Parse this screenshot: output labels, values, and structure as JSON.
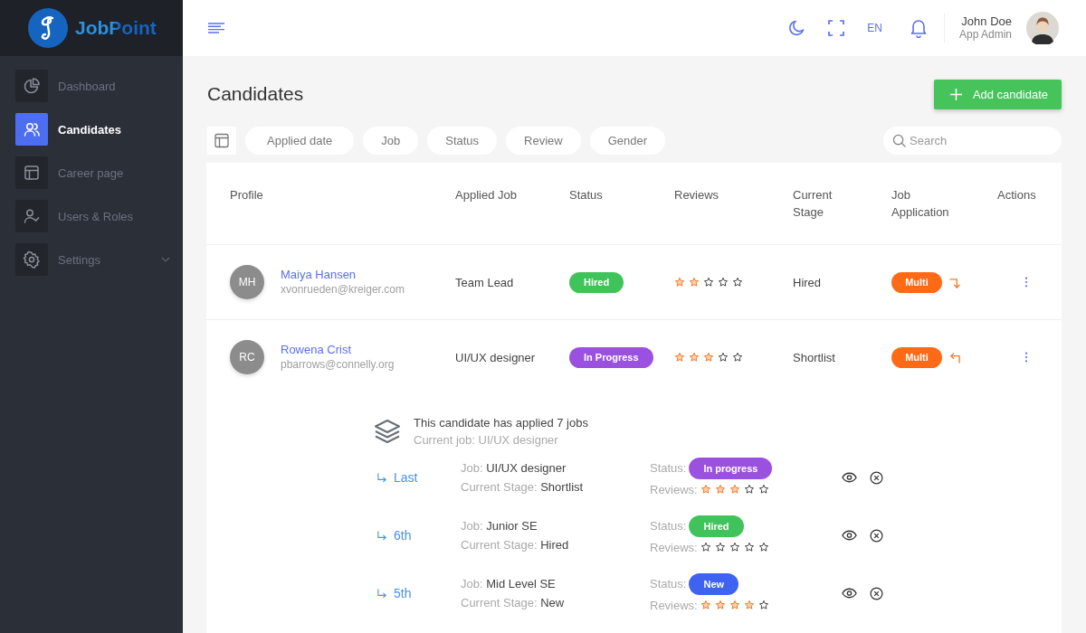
{
  "sidebar": {
    "brand": "JobPoint",
    "items": [
      {
        "label": "Dashboard",
        "selected": false,
        "submenu": false
      },
      {
        "label": "Candidates",
        "selected": true,
        "submenu": false
      },
      {
        "label": "Career page",
        "selected": false,
        "submenu": false
      },
      {
        "label": "Users & Roles",
        "selected": false,
        "submenu": false
      },
      {
        "label": "Settings",
        "selected": false,
        "submenu": true
      }
    ]
  },
  "topbar": {
    "language": "EN",
    "user": {
      "name": "John Doe",
      "role": "App Admin"
    }
  },
  "page": {
    "title": "Candidates",
    "add_button": "Add candidate"
  },
  "filters": {
    "chips": [
      "Applied date",
      "Job",
      "Status",
      "Review",
      "Gender"
    ],
    "search": {
      "placeholder": "Search"
    }
  },
  "table": {
    "columns": [
      "Profile",
      "Applied Job",
      "Status",
      "Reviews",
      "Current Stage",
      "Job Application",
      "Actions"
    ],
    "rows": [
      {
        "initials": "MH",
        "name": "Maiya Hansen",
        "email": "xvonrueden@kreiger.com",
        "job": "Team Lead",
        "status": {
          "label": "Hired",
          "color": "#41c35b"
        },
        "stars": 2,
        "stage": "Hired",
        "application": "Multi",
        "expanded": false
      },
      {
        "initials": "RC",
        "name": "Rowena Crist",
        "email": "pbarrows@connelly.org",
        "job": "UI/UX designer",
        "status": {
          "label": "In Progress",
          "color": "#9b51e0"
        },
        "stars": 3,
        "stage": "Shortlist",
        "application": "Multi",
        "expanded": true,
        "details": {
          "summary": "This candidate has applied 7 jobs",
          "current": "Current job: UI/UX designer",
          "applications": [
            {
              "order": "Last",
              "job_label": "Job:",
              "job": "UI/UX designer",
              "stage_label": "Current Stage:",
              "stage": "Shortlist",
              "status_label": "Status:",
              "status": {
                "label": "In progress",
                "color": "#9b51e0"
              },
              "reviews_label": "Reviews:",
              "stars": 3
            },
            {
              "order": "6th",
              "job_label": "Job:",
              "job": "Junior SE",
              "stage_label": "Current Stage:",
              "stage": "Hired",
              "status_label": "Status:",
              "status": {
                "label": "Hired",
                "color": "#41c35b"
              },
              "reviews_label": "Reviews:",
              "stars": 0
            },
            {
              "order": "5th",
              "job_label": "Job:",
              "job": "Mid Level SE",
              "stage_label": "Current Stage:",
              "stage": "New",
              "status_label": "Status:",
              "status": {
                "label": "New",
                "color": "#3d63f0"
              },
              "reviews_label": "Reviews:",
              "stars": 4
            }
          ]
        }
      }
    ]
  }
}
